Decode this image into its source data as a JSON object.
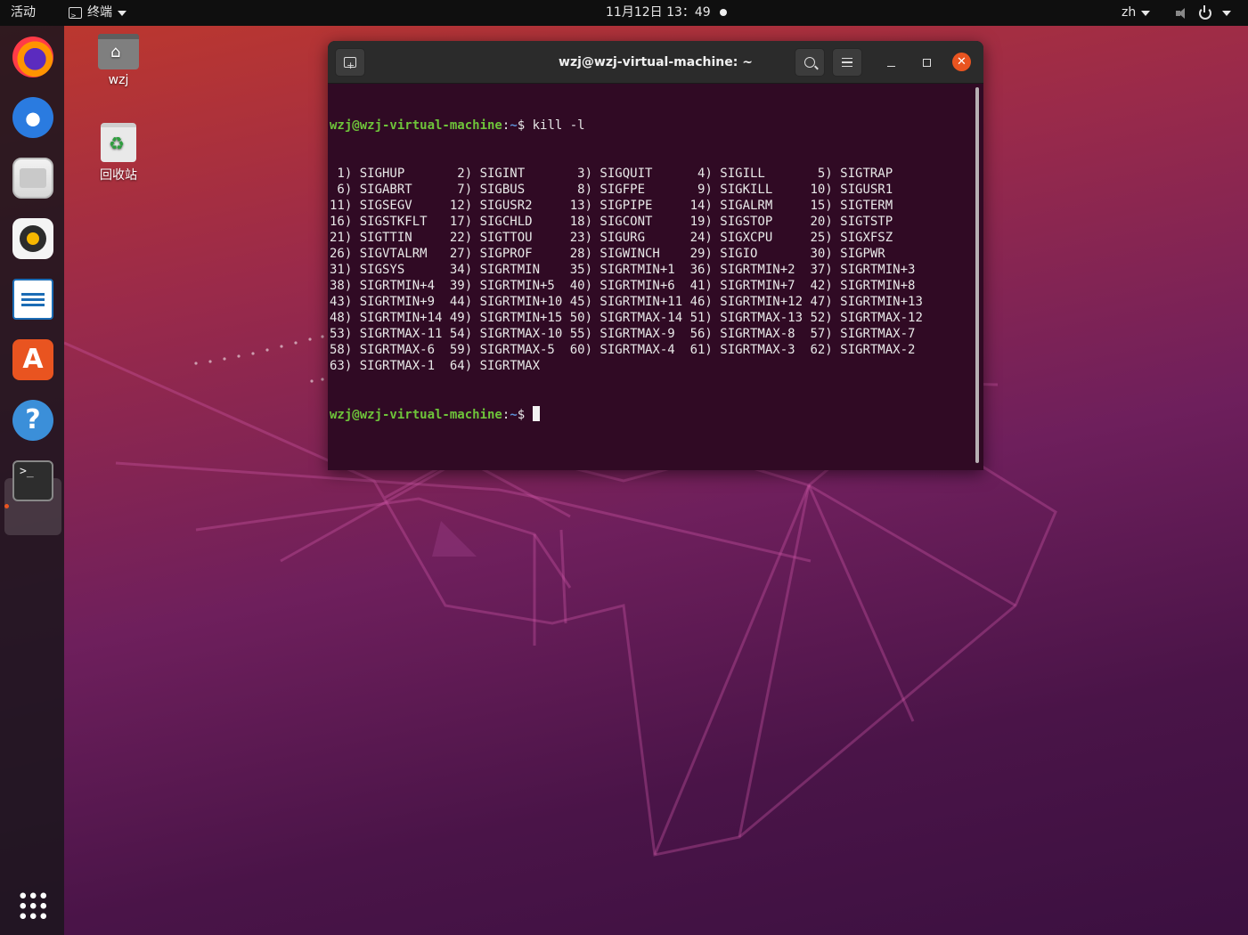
{
  "topbar": {
    "activities": "活动",
    "app_name": "终端",
    "clock": "11月12日  13：49",
    "language": "zh"
  },
  "dock": {
    "items": [
      "firefox",
      "thunderbird",
      "files",
      "rhythmbox",
      "libreoffice-writer",
      "ubuntu-software",
      "help",
      "terminal"
    ],
    "software_glyph": "A",
    "help_glyph": "?",
    "terminal_glyph": ">_"
  },
  "desktop": {
    "home_label": "wzj",
    "trash_label": "回收站"
  },
  "terminal": {
    "title": "wzj@wzj-virtual-machine: ~",
    "prompt_user": "wzj@wzj-virtual-machine",
    "prompt_path": "~",
    "command": "kill -l",
    "output": [
      " 1) SIGHUP       2) SIGINT       3) SIGQUIT      4) SIGILL       5) SIGTRAP",
      " 6) SIGABRT      7) SIGBUS       8) SIGFPE       9) SIGKILL     10) SIGUSR1",
      "11) SIGSEGV     12) SIGUSR2     13) SIGPIPE     14) SIGALRM     15) SIGTERM",
      "16) SIGSTKFLT   17) SIGCHLD     18) SIGCONT     19) SIGSTOP     20) SIGTSTP",
      "21) SIGTTIN     22) SIGTTOU     23) SIGURG      24) SIGXCPU     25) SIGXFSZ",
      "26) SIGVTALRM   27) SIGPROF     28) SIGWINCH    29) SIGIO       30) SIGPWR",
      "31) SIGSYS      34) SIGRTMIN    35) SIGRTMIN+1  36) SIGRTMIN+2  37) SIGRTMIN+3",
      "38) SIGRTMIN+4  39) SIGRTMIN+5  40) SIGRTMIN+6  41) SIGRTMIN+7  42) SIGRTMIN+8",
      "43) SIGRTMIN+9  44) SIGRTMIN+10 45) SIGRTMIN+11 46) SIGRTMIN+12 47) SIGRTMIN+13",
      "48) SIGRTMIN+14 49) SIGRTMIN+15 50) SIGRTMAX-14 51) SIGRTMAX-13 52) SIGRTMAX-12",
      "53) SIGRTMAX-11 54) SIGRTMAX-10 55) SIGRTMAX-9  56) SIGRTMAX-8  57) SIGRTMAX-7",
      "58) SIGRTMAX-6  59) SIGRTMAX-5  60) SIGRTMAX-4  61) SIGRTMAX-3  62) SIGRTMAX-2",
      "63) SIGRTMAX-1  64) SIGRTMAX"
    ]
  },
  "colors": {
    "terminal_bg": "#300a24",
    "prompt_user": "#6ec43a",
    "prompt_path": "#5c8fd4",
    "accent": "#e95420"
  }
}
